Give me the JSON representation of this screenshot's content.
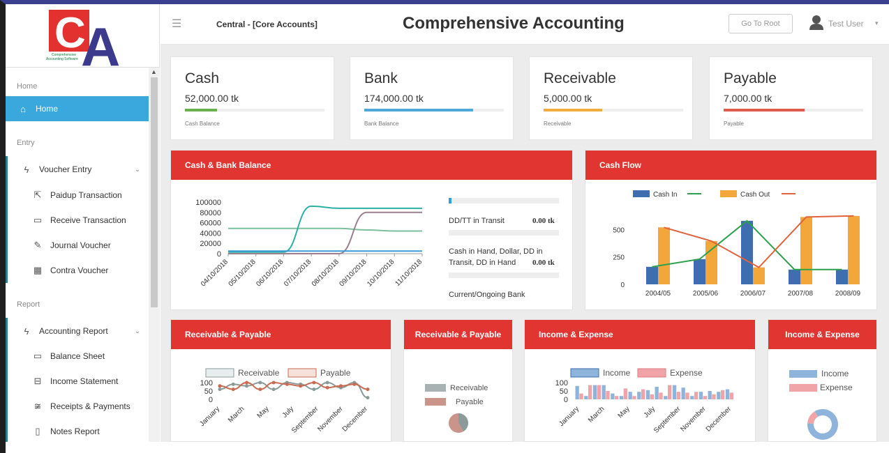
{
  "logo": {
    "letters": "CA",
    "line1": "Comprehensive",
    "line2": "Accounting Software"
  },
  "header": {
    "breadcrumb": "Central - [Core Accounts]",
    "title": "Comprehensive Accounting",
    "go_root": "Go To Root",
    "user": "Test User"
  },
  "sidebar": {
    "section_home": "Home",
    "home": "Home",
    "section_entry": "Entry",
    "voucher_entry": "Voucher Entry",
    "entry_items": [
      "Paidup Transaction",
      "Receive Transaction",
      "Journal Voucher",
      "Contra Voucher"
    ],
    "section_report": "Report",
    "accounting_report": "Accounting Report",
    "report_items": [
      "Balance Sheet",
      "Income Statement",
      "Receipts & Payments",
      "Notes Report"
    ]
  },
  "cards": [
    {
      "title": "Cash",
      "value": "52,000.00 tk",
      "label": "Cash Balance",
      "color": "#6ab04c",
      "progress": 0.23
    },
    {
      "title": "Bank",
      "value": "174,000.00 tk",
      "label": "Bank Balance",
      "color": "#4fa9d8",
      "progress": 0.78
    },
    {
      "title": "Receivable",
      "value": "5,000.00 tk",
      "label": "Receivable",
      "color": "#f0ad3c",
      "progress": 0.42
    },
    {
      "title": "Payable",
      "value": "7,000.00 tk",
      "label": "Payable",
      "color": "#e05a4f",
      "progress": 0.58
    }
  ],
  "panels": {
    "cash_bank": "Cash & Bank Balance",
    "cash_flow": "Cash Flow",
    "rp1": "Receivable & Payable",
    "rp2": "Receivable & Payable",
    "ie1": "Income & Expense",
    "ie2": "Income & Expense"
  },
  "balance_info": {
    "dd_label": "DD/TT in Transit",
    "dd_value": "0.00 tk",
    "cash_hand_label_1": "Cash in Hand, Dollar, DD in",
    "cash_hand_label_2": "Transit, DD in Hand",
    "cash_hand_value": "0.00 tk",
    "current_bank": "Current/Ongoing Bank"
  },
  "colors": {
    "accent": "#e03531",
    "active_nav": "#3aa8dc",
    "topbar": "#3a3f8f"
  },
  "chart_data": [
    {
      "type": "line",
      "x": [
        "04/10/2018",
        "05/10/2018",
        "06/10/2018",
        "07/10/2018",
        "08/10/2018",
        "09/10/2018",
        "10/10/2018",
        "11/10/2018"
      ],
      "series": [
        {
          "color": "#7dbf9e",
          "values": [
            49000,
            49000,
            49000,
            49000,
            49000,
            46000,
            44000,
            44000
          ]
        },
        {
          "color": "#2bb0a6",
          "values": [
            3000,
            3000,
            3000,
            92000,
            88000,
            88000,
            88000,
            88000
          ]
        },
        {
          "color": "#9a7f8f",
          "values": [
            0,
            0,
            0,
            0,
            0,
            80000,
            80000,
            80000
          ]
        },
        {
          "color": "#3a9ad9",
          "values": [
            5000,
            5000,
            5000,
            5000,
            5000,
            5000,
            5000,
            5000
          ]
        }
      ],
      "yticks": [
        "100000",
        "80000",
        "60000",
        "40000",
        "20000",
        "0"
      ],
      "ylim": [
        0,
        100000
      ]
    },
    {
      "type": "bar",
      "categories": [
        "2004/05",
        "2005/06",
        "2006/07",
        "2007/08",
        "2008/09"
      ],
      "series": [
        {
          "name": "Cash In",
          "type": "bar",
          "color": "#3e6eb0",
          "values": [
            160,
            230,
            580,
            135,
            135
          ]
        },
        {
          "name": "Cash Out",
          "type": "bar",
          "color": "#f3a73b",
          "values": [
            520,
            395,
            155,
            615,
            625
          ]
        },
        {
          "name": "",
          "type": "line",
          "color": "#2ca04a",
          "values": [
            160,
            230,
            580,
            135,
            135
          ]
        },
        {
          "name": "",
          "type": "line",
          "color": "#e0633c",
          "values": [
            520,
            395,
            155,
            615,
            625
          ]
        }
      ],
      "legend": [
        "Cash In",
        "Cash Out"
      ],
      "yticks": [
        "500",
        "250",
        "0"
      ],
      "ylim": [
        0,
        700
      ]
    },
    {
      "type": "line",
      "categories": [
        "January",
        "March",
        "May",
        "July",
        "September",
        "November",
        "December"
      ],
      "series": [
        {
          "name": "Receivable",
          "color": "#8a9a9a",
          "values": [
            60,
            90,
            80,
            100,
            60,
            100,
            90,
            60,
            100,
            70,
            100,
            10
          ]
        },
        {
          "name": "Payable",
          "color": "#c96b52",
          "values": [
            80,
            60,
            100,
            60,
            100,
            90,
            80,
            100,
            70,
            80,
            90,
            60
          ]
        }
      ],
      "yticks": [
        "100",
        "50",
        "0"
      ],
      "ylim": [
        0,
        100
      ]
    },
    {
      "type": "pie",
      "legend": [
        "Receivable",
        "Payable"
      ],
      "colors": [
        "#a8b2b2",
        "#c9948a"
      ],
      "values": [
        5000,
        7000
      ]
    },
    {
      "type": "bar",
      "categories": [
        "January",
        "March",
        "May",
        "July",
        "September",
        "November",
        "December"
      ],
      "series": [
        {
          "name": "Income",
          "color": "#8fb4dc",
          "values": [
            80,
            20,
            85,
            85,
            35,
            20,
            45,
            45,
            55,
            75,
            20,
            85,
            70,
            20,
            45,
            50,
            45,
            60
          ]
        },
        {
          "name": "Expense",
          "color": "#f0a4a8",
          "values": [
            35,
            85,
            85,
            50,
            20,
            65,
            20,
            60,
            30,
            40,
            85,
            45,
            40,
            45,
            20,
            30,
            55,
            40
          ]
        }
      ],
      "yticks": [
        "100",
        "50",
        "0"
      ],
      "ylim": [
        0,
        100
      ]
    },
    {
      "type": "pie",
      "legend": [
        "Income",
        "Expense"
      ],
      "colors": [
        "#8fb4dc",
        "#f0a4a8"
      ],
      "values": [
        85,
        15
      ]
    }
  ]
}
